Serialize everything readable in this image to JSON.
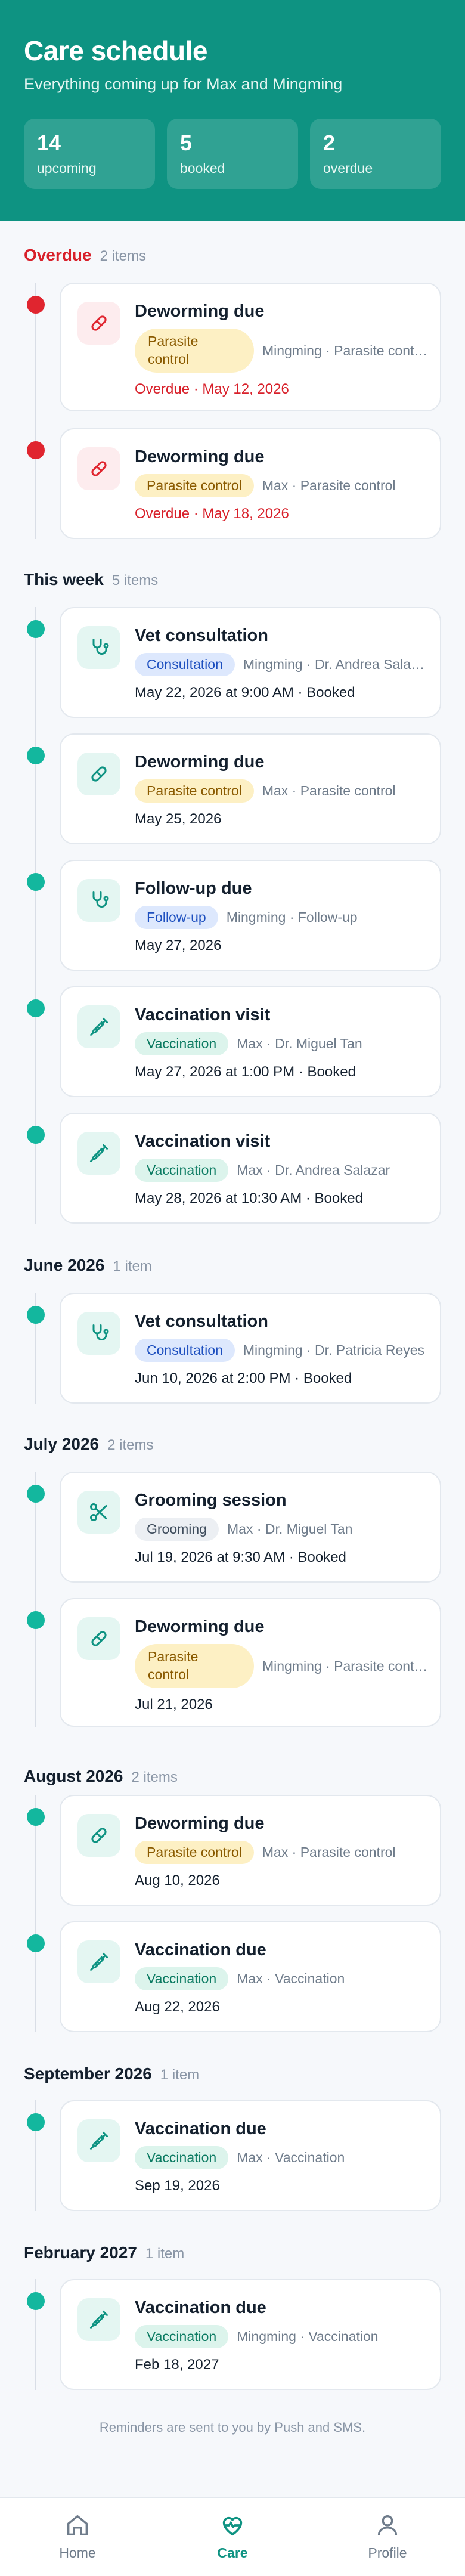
{
  "header": {
    "title": "Care schedule",
    "subtitle": "Everything coming up for Max and Mingming",
    "stats": [
      {
        "value": "14",
        "label": "upcoming"
      },
      {
        "value": "5",
        "label": "booked"
      },
      {
        "value": "2",
        "label": "overdue"
      }
    ]
  },
  "sections": [
    {
      "title": "Overdue",
      "count": "2 items",
      "items": [
        {
          "title": "Deworming due",
          "tag": "Parasite control",
          "meta": "Mingming · Parasite control",
          "date": "Overdue · May 12, 2026"
        },
        {
          "title": "Deworming due",
          "tag": "Parasite control",
          "meta": "Max · Parasite control",
          "date": "Overdue · May 18, 2026"
        }
      ]
    },
    {
      "title": "This week",
      "count": "5 items",
      "items": [
        {
          "title": "Vet consultation",
          "tag": "Consultation",
          "meta": "Mingming · Dr. Andrea Salazar",
          "date": "May 22, 2026 at 9:00 AM · Booked"
        },
        {
          "title": "Deworming due",
          "tag": "Parasite control",
          "meta": "Max · Parasite control",
          "date": "May 25, 2026"
        },
        {
          "title": "Follow-up due",
          "tag": "Follow-up",
          "meta": "Mingming · Follow-up",
          "date": "May 27, 2026"
        },
        {
          "title": "Vaccination visit",
          "tag": "Vaccination",
          "meta": "Max · Dr. Miguel Tan",
          "date": "May 27, 2026 at 1:00 PM · Booked"
        },
        {
          "title": "Vaccination visit",
          "tag": "Vaccination",
          "meta": "Max · Dr. Andrea Salazar",
          "date": "May 28, 2026 at 10:30 AM · Booked"
        }
      ]
    },
    {
      "title": "June 2026",
      "count": "1 item",
      "items": [
        {
          "title": "Vet consultation",
          "tag": "Consultation",
          "meta": "Mingming · Dr. Patricia Reyes",
          "date": "Jun 10, 2026 at 2:00 PM · Booked"
        }
      ]
    },
    {
      "title": "July 2026",
      "count": "2 items",
      "items": [
        {
          "title": "Grooming session",
          "tag": "Grooming",
          "meta": "Max · Dr. Miguel Tan",
          "date": "Jul 19, 2026 at 9:30 AM · Booked"
        },
        {
          "title": "Deworming due",
          "tag": "Parasite control",
          "meta": "Mingming · Parasite control",
          "date": "Jul 21, 2026"
        }
      ]
    },
    {
      "title": "August 2026",
      "count": "2 items",
      "items": [
        {
          "title": "Deworming due",
          "tag": "Parasite control",
          "meta": "Max · Parasite control",
          "date": "Aug 10, 2026"
        },
        {
          "title": "Vaccination due",
          "tag": "Vaccination",
          "meta": "Max · Vaccination",
          "date": "Aug 22, 2026"
        }
      ]
    },
    {
      "title": "September 2026",
      "count": "1 item",
      "items": [
        {
          "title": "Vaccination due",
          "tag": "Vaccination",
          "meta": "Max · Vaccination",
          "date": "Sep 19, 2026"
        }
      ]
    },
    {
      "title": "February 2027",
      "count": "1 item",
      "items": [
        {
          "title": "Vaccination due",
          "tag": "Vaccination",
          "meta": "Mingming · Vaccination",
          "date": "Feb 18, 2027"
        }
      ]
    }
  ],
  "footer_note": "Reminders are sent to you by Push and SMS.",
  "nav": [
    {
      "label": "Home",
      "icon": "home-icon"
    },
    {
      "label": "Care",
      "icon": "heart-pulse-icon"
    },
    {
      "label": "Profile",
      "icon": "user-icon"
    }
  ],
  "colors": {
    "brand": "#0e9382",
    "overdue": "#e0252f",
    "upcoming": "#13b79e"
  }
}
